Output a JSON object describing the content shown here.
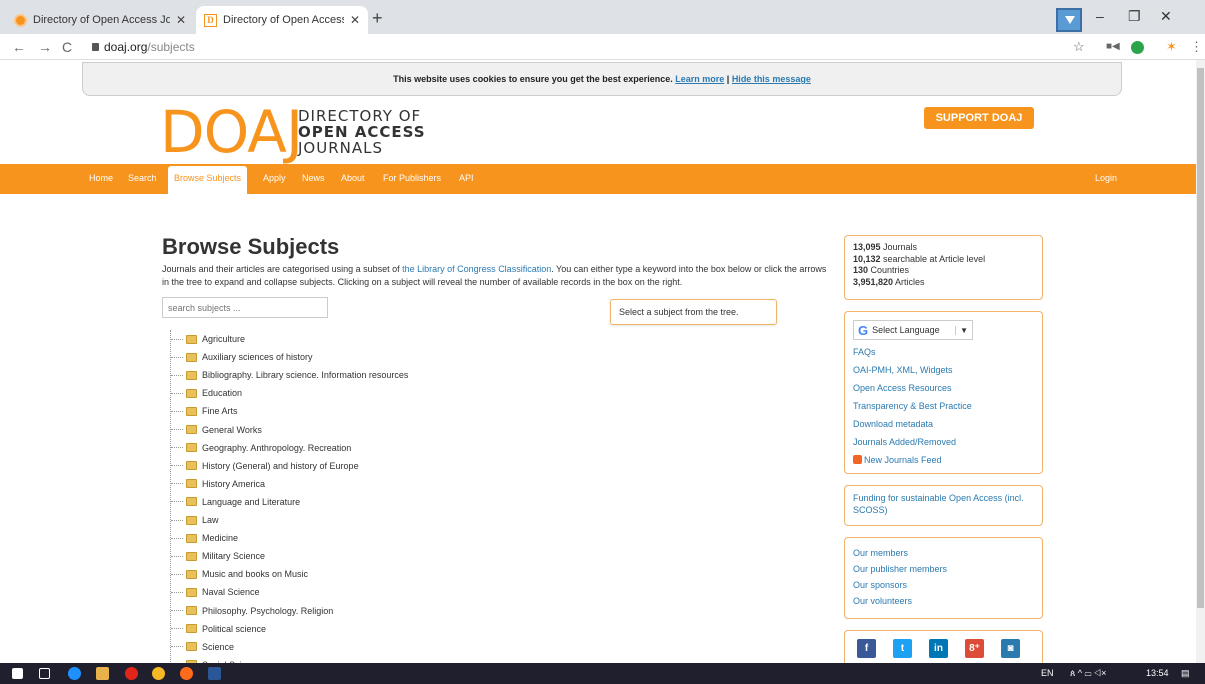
{
  "browser": {
    "tabs": [
      {
        "title": "Directory of Open Access Journa",
        "close": "✕"
      },
      {
        "title": "Directory of Open Access Journa",
        "close": "✕"
      }
    ],
    "new_tab": "+",
    "window_controls": {
      "minimize": "–",
      "restore": "❐",
      "close": "✕"
    },
    "address": {
      "host": "doaj.org",
      "path": "/subjects"
    },
    "nav_icons": [
      "back-icon",
      "forward-icon",
      "reload-icon"
    ]
  },
  "cookie_banner": {
    "text": "This website uses cookies to ensure you get the best experience. ",
    "learn_more": "Learn more",
    "separator": " | ",
    "hide": "Hide this message"
  },
  "header": {
    "logo_mark": "DOAJ",
    "logo_line1": "DIRECTORY OF",
    "logo_line2": "OPEN ACCESS",
    "logo_line3": "JOURNALS",
    "support_button": "SUPPORT DOAJ"
  },
  "nav": {
    "items": [
      "Home",
      "Search",
      "Browse Subjects",
      "Apply",
      "News",
      "About",
      "For Publishers",
      "API"
    ],
    "active": "Browse Subjects",
    "login": "Login"
  },
  "main": {
    "title": "Browse Subjects",
    "intro_part1": "Journals and their articles are categorised using a subset of ",
    "intro_link": "the Library of Congress Classification",
    "intro_part2": ". You can either type a keyword into the box below or click the arrows in the tree to expand and collapse subjects. Clicking on a subject will reveal the number of available records in the box on the right.",
    "search_placeholder": "search subjects ...",
    "select_prompt": "Select a subject from the tree.",
    "subjects": [
      "Agriculture",
      "Auxiliary sciences of history",
      "Bibliography. Library science. Information resources",
      "Education",
      "Fine Arts",
      "General Works",
      "Geography. Anthropology. Recreation",
      "History (General) and history of Europe",
      "History America",
      "Language and Literature",
      "Law",
      "Medicine",
      "Military Science",
      "Music and books on Music",
      "Naval Science",
      "Philosophy. Psychology. Religion",
      "Political science",
      "Science",
      "Social Sciences"
    ]
  },
  "sidebar": {
    "stats": [
      {
        "value": "13,095",
        "label": " Journals"
      },
      {
        "value": "10,132",
        "label": " searchable at Article level"
      },
      {
        "value": "130",
        "label": " Countries"
      },
      {
        "value": "3,951,820",
        "label": " Articles"
      }
    ],
    "language_button": "Select Language",
    "links": [
      "FAQs",
      "OAI-PMH, XML, Widgets",
      "Open Access Resources",
      "Transparency & Best Practice",
      "Download metadata",
      "Journals Added/Removed"
    ],
    "feed_link": "New Journals Feed",
    "funding_link": "Funding for sustainable Open Access (incl. SCOSS)",
    "member_links": [
      "Our members",
      "Our publisher members",
      "Our sponsors",
      "Our volunteers"
    ],
    "social": [
      {
        "icon": "facebook-icon",
        "glyph": "f",
        "color": "#3b5998"
      },
      {
        "icon": "twitter-icon",
        "glyph": "t",
        "color": "#1da1f2"
      },
      {
        "icon": "linkedin-icon",
        "glyph": "in",
        "color": "#0077b5"
      },
      {
        "icon": "google-plus-icon",
        "glyph": "8⁺",
        "color": "#dd4b39"
      },
      {
        "icon": "instagram-icon",
        "glyph": "◙",
        "color": "#2a7ab0"
      }
    ]
  },
  "taskbar": {
    "lang": "EN",
    "time": "13:54"
  },
  "colors": {
    "brand_orange": "#f7941d",
    "link_blue": "#2a7ab0"
  }
}
